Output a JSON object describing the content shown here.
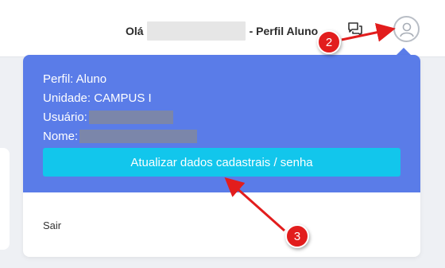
{
  "header": {
    "greeting_prefix": "Olá",
    "greeting_suffix": "- Perfil Aluno",
    "chat_icon": "chat-bubbles-icon",
    "avatar_icon": "user-avatar-icon"
  },
  "profile_menu": {
    "perfil": "Perfil: Aluno",
    "unidade": "Unidade: CAMPUS I",
    "usuario_label": "Usuário:",
    "nome_label": "Nome:",
    "update_button": "Atualizar dados cadastrais / senha",
    "logout": "Sair"
  },
  "annotations": {
    "badge_2": "2",
    "badge_3": "3"
  },
  "colors": {
    "panel_blue": "#5a7ce8",
    "button_cyan": "#12c6ec",
    "annotation_red": "#e21d1d"
  }
}
